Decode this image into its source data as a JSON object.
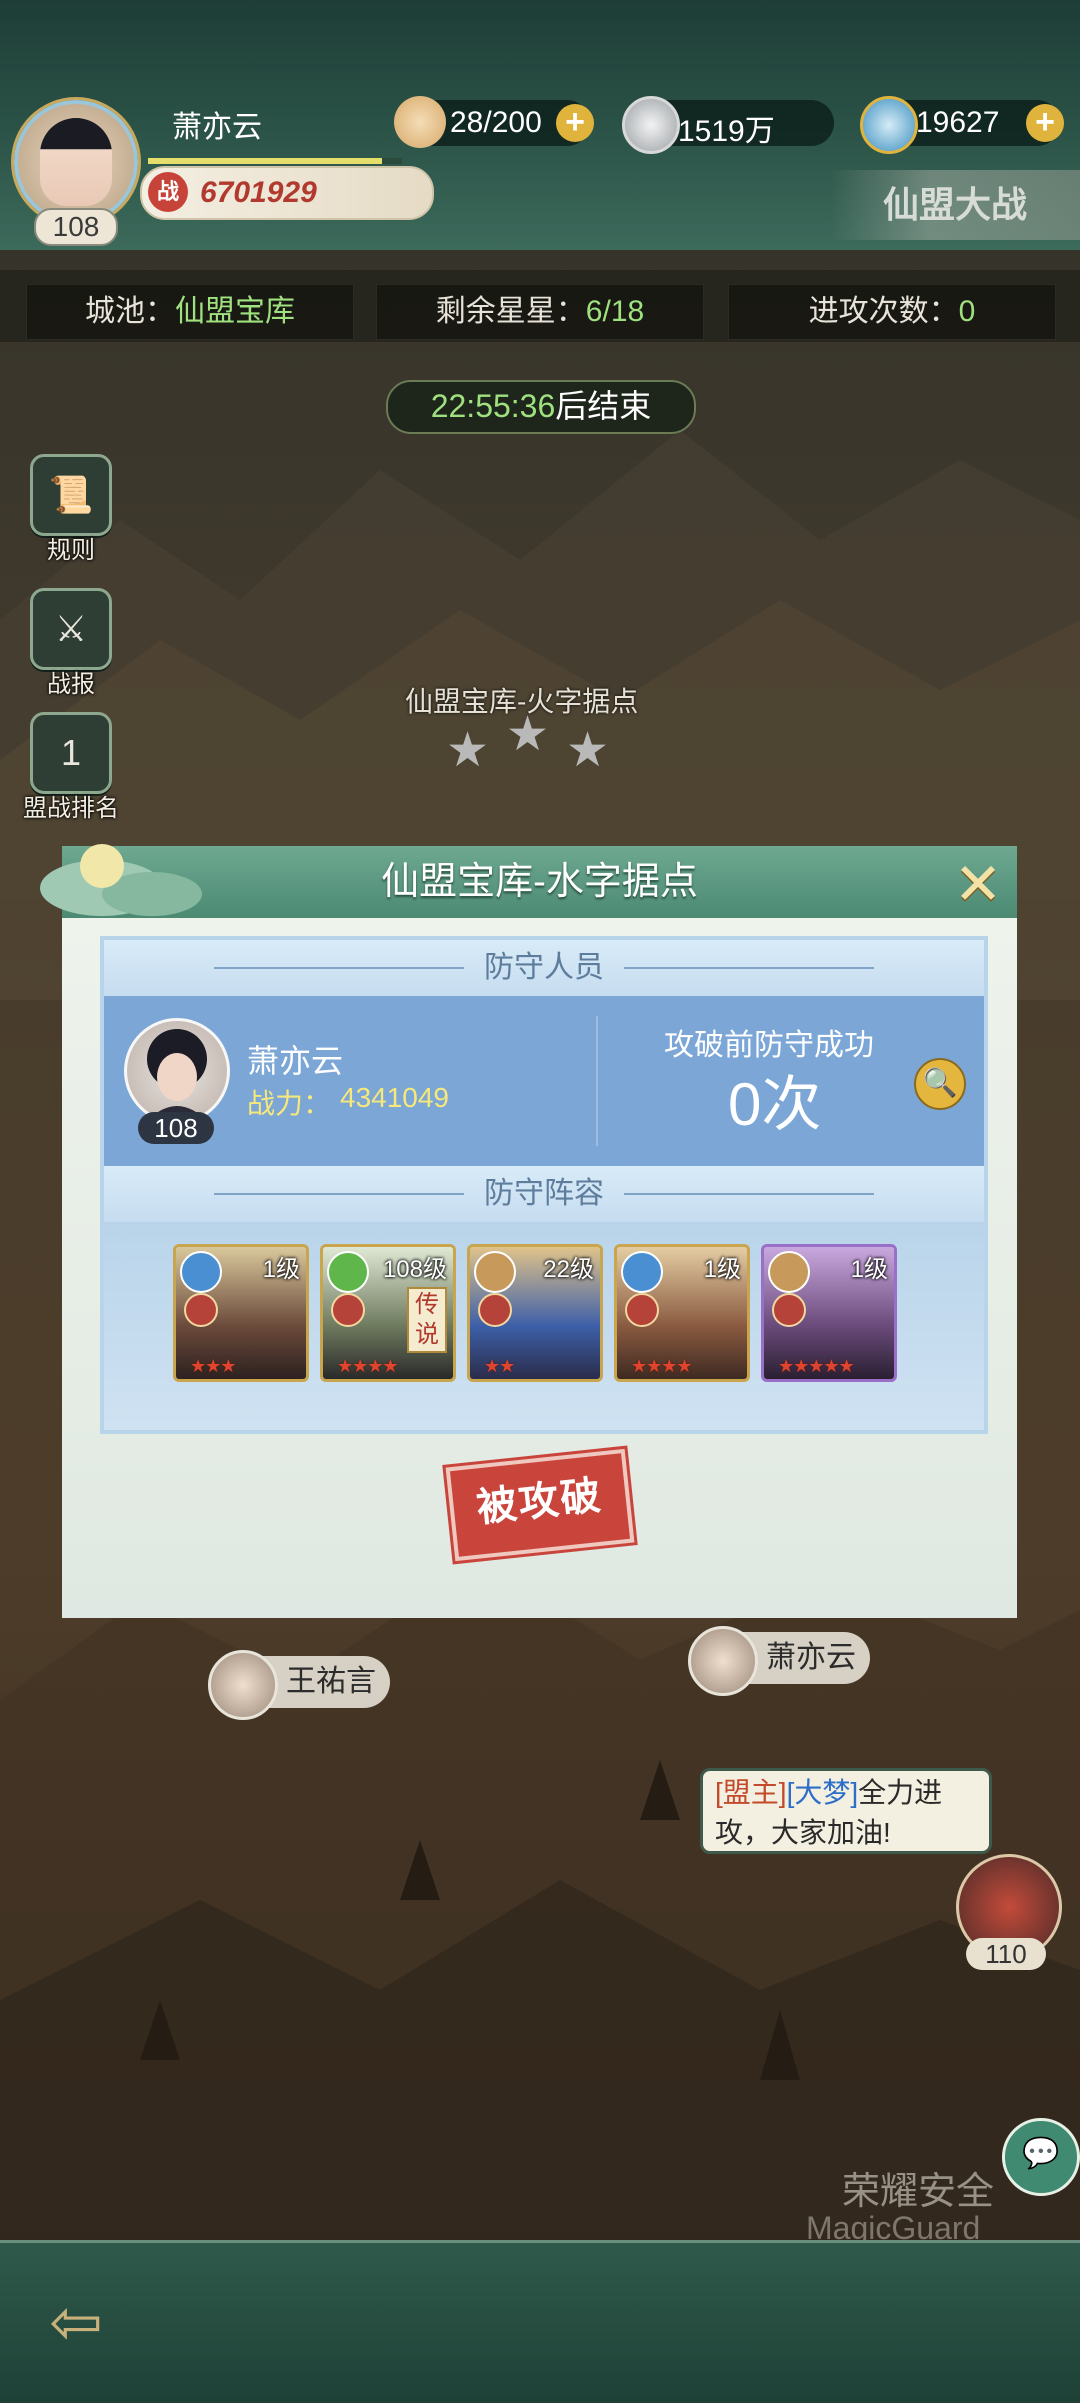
{
  "player": {
    "name": "萧亦云",
    "level": "108",
    "power_icon": "战",
    "power": "6701929",
    "exp_fraction": 0.92
  },
  "resources": [
    {
      "icon": "bun-icon",
      "value": "28/200"
    },
    {
      "icon": "coin-icon",
      "value": "1519万"
    },
    {
      "icon": "spiral-gem-icon",
      "value": "19627"
    }
  ],
  "event_title": "仙盟大战",
  "info": {
    "city_label": "城池：",
    "city_value": "仙盟宝库",
    "stars_label": "剩余星星：",
    "stars_value": "6/18",
    "attacks_label": "进攻次数：",
    "attacks_value": "0"
  },
  "timer": {
    "time": "22:55:36",
    "suffix": "后结束"
  },
  "side_buttons": [
    {
      "label": "规则",
      "glyph": "📜"
    },
    {
      "label": "战报",
      "glyph": "⚔"
    },
    {
      "label": "盟战排名",
      "glyph": "1"
    }
  ],
  "map": {
    "node_label": "仙盟宝库-火字据点",
    "stars_filled": 0,
    "stars_total": 3
  },
  "popup": {
    "title": "仙盟宝库-水字据点",
    "close_glyph": "✕",
    "defenders_header": "防守人员",
    "defender": {
      "name": "萧亦云",
      "level": "108",
      "power_label": "战力：",
      "power": "4341049"
    },
    "success_label": "攻破前防守成功",
    "success_count": "0次",
    "lineup_header": "防守阵容",
    "heroes": [
      {
        "level": "1级",
        "element": "water",
        "stars": 3,
        "legend": ""
      },
      {
        "level": "108级",
        "element": "wind",
        "stars": 4,
        "legend": "传说"
      },
      {
        "level": "22级",
        "element": "earth",
        "stars": 2,
        "legend": ""
      },
      {
        "level": "1级",
        "element": "water",
        "stars": 4,
        "legend": ""
      },
      {
        "level": "1级",
        "element": "earth",
        "stars": 5,
        "legend": ""
      }
    ],
    "status_stamp": "被攻破"
  },
  "map_players": [
    {
      "name": "王祐言"
    },
    {
      "name": "萧亦云"
    }
  ],
  "chat": {
    "tag": "[盟主]",
    "speaker": "[大梦]",
    "line1": "全力进",
    "line2": "攻，大家加油!",
    "speaker_level": "110"
  },
  "watermark": {
    "line1": "荣耀安全",
    "line2": "MagicGuard"
  },
  "colors": {
    "accent_green": "#9fe07f",
    "stamp_red": "#c9453b",
    "gold": "#e0b33d"
  }
}
